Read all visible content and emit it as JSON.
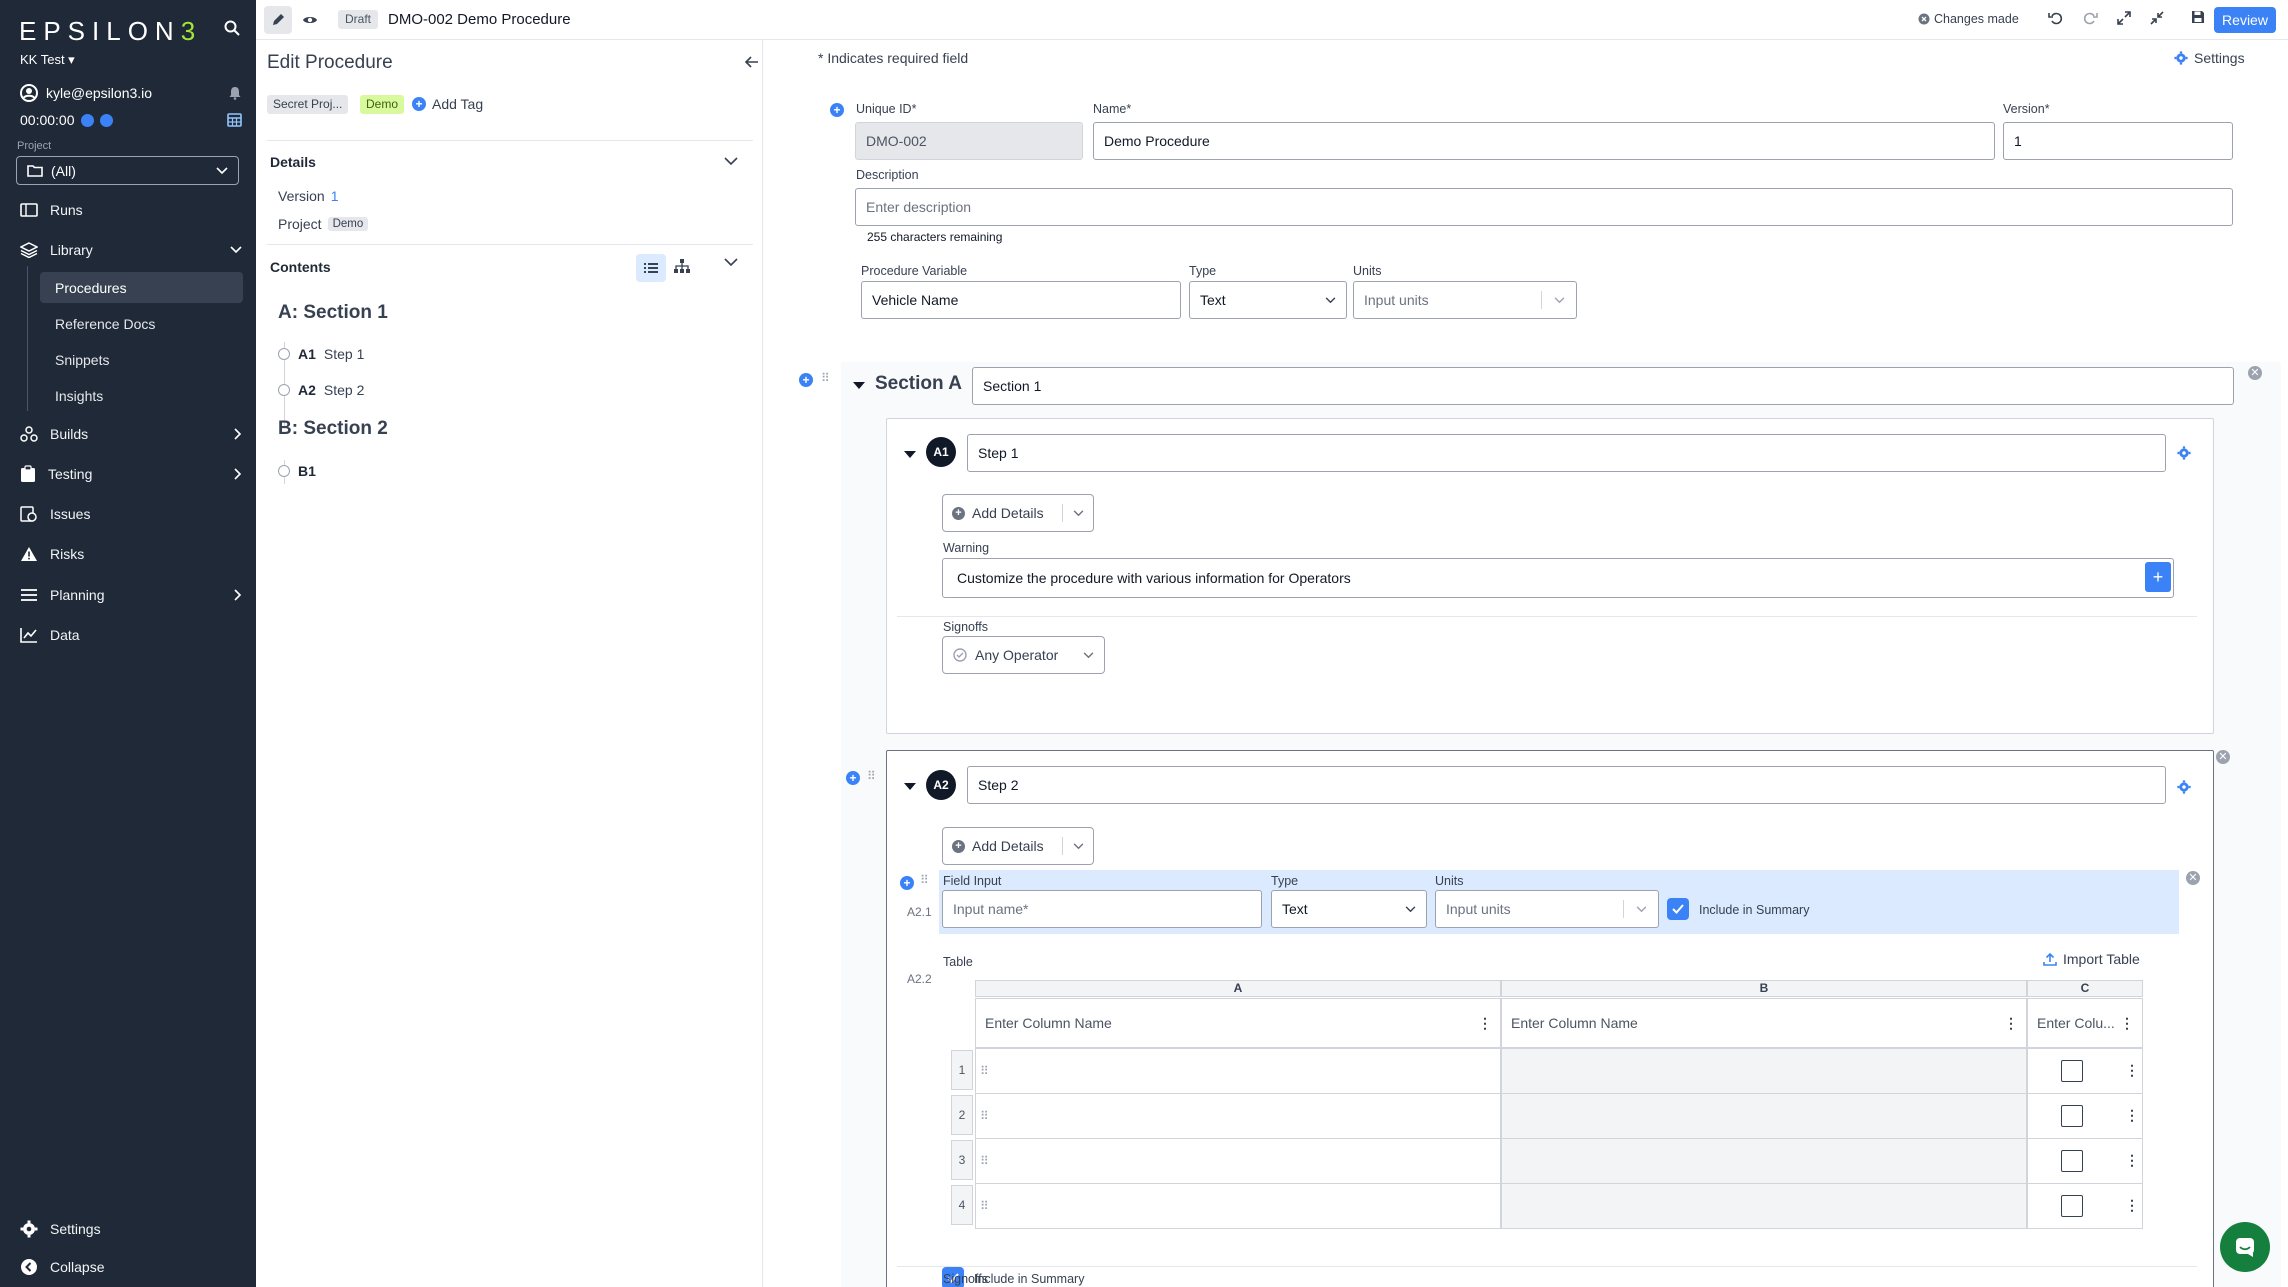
{
  "nav": {
    "logo": "EPSILON3",
    "team": "KK Test",
    "user_email": "kyle@epsilon3.io",
    "timer": "00:00:00",
    "project_label": "Project",
    "project_value": "(All)",
    "items": {
      "runs": "Runs",
      "library": "Library",
      "procedures": "Procedures",
      "reference_docs": "Reference Docs",
      "snippets": "Snippets",
      "insights": "Insights",
      "builds": "Builds",
      "testing": "Testing",
      "issues": "Issues",
      "risks": "Risks",
      "planning": "Planning",
      "data": "Data",
      "settings": "Settings",
      "collapse": "Collapse"
    }
  },
  "topbar": {
    "status_badge": "Draft",
    "title": "DMO-002 Demo Procedure",
    "changes": "Changes made",
    "review": "Review"
  },
  "edit_panel": {
    "title": "Edit Procedure",
    "tags": [
      "Secret Proj...",
      "Demo"
    ],
    "add_tag": "Add Tag",
    "details_head": "Details",
    "version_label": "Version",
    "version_value": "1",
    "project_label": "Project",
    "project_value": "Demo",
    "contents_head": "Contents",
    "tree": {
      "section_a": "A: Section 1",
      "a1_id": "A1",
      "a1_name": "Step 1",
      "a2_id": "A2",
      "a2_name": "Step 2",
      "section_b": "B: Section 2",
      "b1_id": "B1"
    }
  },
  "form": {
    "required_note": "* Indicates required field",
    "settings": "Settings",
    "unique_id_label": "Unique ID*",
    "unique_id_value": "DMO-002",
    "name_label": "Name*",
    "name_value": "Demo Procedure",
    "version_label": "Version*",
    "version_value": "1",
    "description_label": "Description",
    "description_placeholder": "Enter description",
    "chars_remaining": "255 characters remaining",
    "proc_var_label": "Procedure Variable",
    "proc_var_value": "Vehicle Name",
    "type_label": "Type",
    "type_value": "Text",
    "units_label": "Units",
    "units_placeholder": "Input units"
  },
  "section_a": {
    "title": "Section A",
    "name_value": "Section 1",
    "step1": {
      "id": "A1",
      "name": "Step 1",
      "add_details": "Add Details",
      "warning_label": "Warning",
      "warning_text": "Customize the procedure with various information for Operators",
      "signoffs_label": "Signoffs",
      "signoff_value": "Any Operator"
    },
    "step2": {
      "id": "A2",
      "name": "Step 2",
      "add_details": "Add Details",
      "field_input_label": "Field Input",
      "field_num": "A2.1",
      "field_name_placeholder": "Input name*",
      "type_label": "Type",
      "type_value": "Text",
      "units_label": "Units",
      "units_placeholder": "Input units",
      "include_summary": "Include in Summary",
      "table_label": "Table",
      "table_num": "A2.2",
      "import_table": "Import Table",
      "columns": [
        "A",
        "B",
        "C"
      ],
      "column_names": [
        "Enter Column Name",
        "Enter Column Name",
        "Enter Colu..."
      ],
      "rows": [
        "1",
        "2",
        "3",
        "4"
      ],
      "table_include_summary": "Include in Summary",
      "signoffs_label": "Signoffs"
    }
  },
  "colors": {
    "accent": "#3b82f6",
    "nav_bg": "#1f2937",
    "lime": "#a3e635"
  }
}
